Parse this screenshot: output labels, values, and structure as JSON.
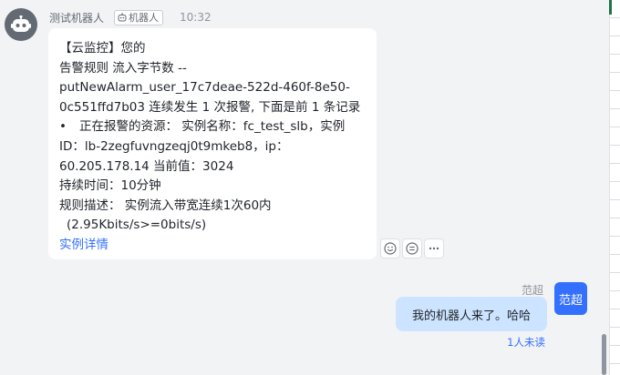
{
  "bot_message": {
    "sender_name": "测试机器人",
    "sender_tag": "机器人",
    "time": "10:32",
    "content": {
      "title_line": "【云监控】您的",
      "rule_line": "告警规则 流入字节数 --",
      "rule_id_line": "putNewAlarm_user_17c7deae-522d-460f-8e50-",
      "rule_tail_line": "0c551ffd7b03 连续发生 1 次报警, 下面是前 1 条记录",
      "resource_line_1": "正在报警的资源： 实例名称：fc_test_slb，实例",
      "resource_line_2": "ID：lb-2zegfuvngzeqj0t9mkeb8，ip：",
      "resource_line_3": "60.205.178.14 当前值：3024",
      "duration_line": "持续时间：10分钟",
      "description_line_1": "规则描述： 实例流入带宽连续1次60内",
      "description_line_2": "(2.95Kbits/s>=0bits/s)",
      "detail_link": "实例详情"
    },
    "icons": {
      "avatar": "robot-icon",
      "tag": "robot-tag-icon",
      "reactions": [
        "emoji-reaction-icon",
        "reply-icon",
        "more-icon"
      ]
    }
  },
  "user_message": {
    "sender_name": "范超",
    "avatar_text": "范超",
    "text": "我的机器人来了。哈哈",
    "read_status": "1人未读"
  },
  "colors": {
    "background": "#f2f3f5",
    "user_bubble": "#cce4ff",
    "accent": "#3370ff",
    "bot_avatar": "#646a73"
  }
}
